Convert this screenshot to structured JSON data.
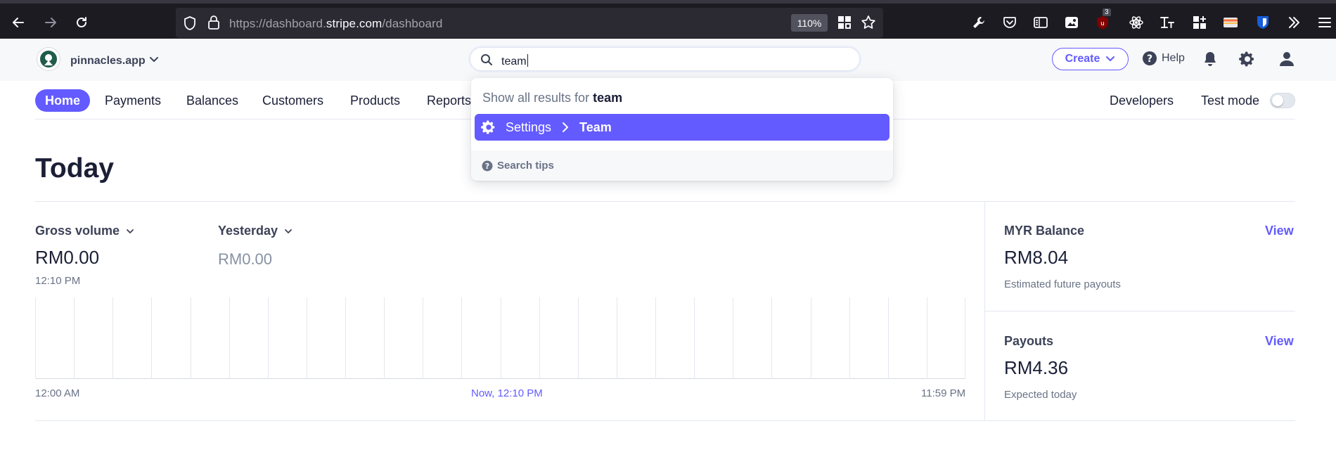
{
  "browser": {
    "url_prefix": "https://dashboard.",
    "url_domain": "stripe.com",
    "url_path": "/dashboard",
    "zoom": "110%",
    "extension_badge": "3"
  },
  "header": {
    "account_name": "pinnacles.app",
    "search_value": "team",
    "create_label": "Create",
    "help_label": "Help"
  },
  "nav": {
    "tabs": [
      "Home",
      "Payments",
      "Balances",
      "Customers",
      "Products",
      "Reports"
    ],
    "developers_label": "Developers",
    "test_mode_label": "Test mode",
    "test_mode_on": false
  },
  "search_dropdown": {
    "show_all_prefix": "Show all results for",
    "term": "team",
    "result_section": "Settings",
    "result_item": "Team",
    "search_tips": "Search tips"
  },
  "today": {
    "title": "Today",
    "gross_volume_label": "Gross volume",
    "gross_volume_value": "RM0.00",
    "gross_volume_time": "12:10 PM",
    "yesterday_label": "Yesterday",
    "yesterday_value": "RM0.00",
    "axis_start": "12:00 AM",
    "axis_now": "Now, 12:10 PM",
    "axis_end": "11:59 PM"
  },
  "sidebar": {
    "balance_label": "MYR Balance",
    "balance_link": "View",
    "balance_value": "RM8.04",
    "balance_sub": "Estimated future payouts",
    "payouts_label": "Payouts",
    "payouts_link": "View",
    "payouts_value": "RM4.36",
    "payouts_sub": "Expected today"
  },
  "colors": {
    "accent": "#635bff",
    "text_primary": "#1a1f36",
    "text_secondary": "#697386",
    "browser_chrome": "#1c1b22"
  }
}
